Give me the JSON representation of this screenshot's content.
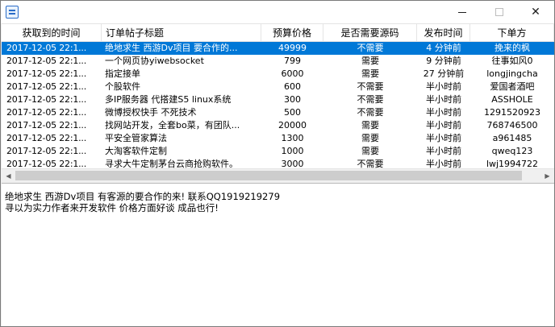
{
  "window": {
    "icon": "app-icon",
    "controls": {
      "minimize": "minimize-icon",
      "maximize": "maximize-icon",
      "close": "✕"
    }
  },
  "table": {
    "columns": [
      "获取到的时间",
      "订单帖子标题",
      "预算价格",
      "是否需要源码",
      "发布时间",
      "下单方"
    ],
    "rows": [
      {
        "time": "2017-12-05 22:1...",
        "title": "绝地求生 西游Dv项目 要合作的...",
        "budget": "49999",
        "source": "不需要",
        "posted": "4 分钟前",
        "client": "挽来的枫",
        "selected": true
      },
      {
        "time": "2017-12-05 22:1...",
        "title": "一个网页协yiwebsocket",
        "budget": "799",
        "source": "需要",
        "posted": "9 分钟前",
        "client": "往事如风0",
        "selected": false
      },
      {
        "time": "2017-12-05 22:1...",
        "title": "指定接单",
        "budget": "6000",
        "source": "需要",
        "posted": "27 分钟前",
        "client": "longjingcha",
        "selected": false
      },
      {
        "time": "2017-12-05 22:1...",
        "title": "个股软件",
        "budget": "600",
        "source": "不需要",
        "posted": "半小时前",
        "client": "爱国者酒吧",
        "selected": false
      },
      {
        "time": "2017-12-05 22:1...",
        "title": "多IP服务器 代搭建S5 linux系统",
        "budget": "300",
        "source": "不需要",
        "posted": "半小时前",
        "client": "ASSHOLE",
        "selected": false
      },
      {
        "time": "2017-12-05 22:1...",
        "title": "微博授权快手 不死技术",
        "budget": "500",
        "source": "不需要",
        "posted": "半小时前",
        "client": "1291520923",
        "selected": false
      },
      {
        "time": "2017-12-05 22:1...",
        "title": "找网站开发，全套bo菜，有团队...",
        "budget": "20000",
        "source": "需要",
        "posted": "半小时前",
        "client": "768746500",
        "selected": false
      },
      {
        "time": "2017-12-05 22:1...",
        "title": "平安全管家算法",
        "budget": "1300",
        "source": "需要",
        "posted": "半小时前",
        "client": "a961485",
        "selected": false
      },
      {
        "time": "2017-12-05 22:1...",
        "title": "大淘客软件定制",
        "budget": "1000",
        "source": "需要",
        "posted": "半小时前",
        "client": "qweq123",
        "selected": false
      },
      {
        "time": "2017-12-05 22:1...",
        "title": "寻求大牛定制茅台云商抢购软件。",
        "budget": "3000",
        "source": "不需要",
        "posted": "半小时前",
        "client": "lwj1994722",
        "selected": false
      }
    ]
  },
  "scrollbar": {
    "left_arrow": "◀",
    "right_arrow": "▶"
  },
  "detail": {
    "text": "绝地求生 西游Dv项目 有客源的要合作的来! 联系QQ1919219279\n寻以为实力作者来开发软件 价格方面好谈 成品也行!"
  }
}
